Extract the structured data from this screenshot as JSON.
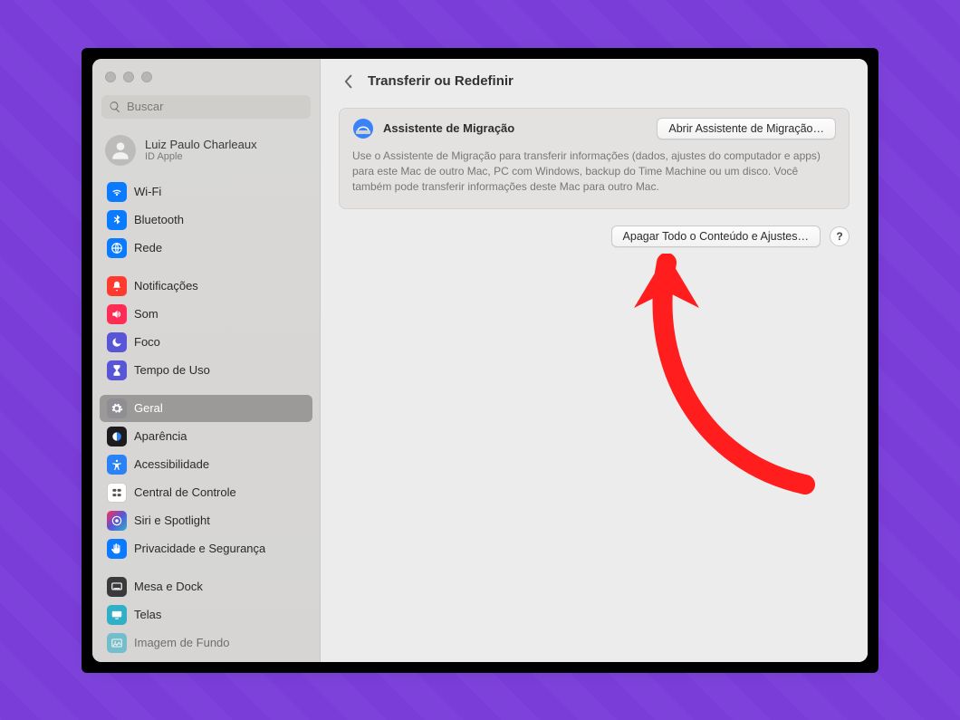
{
  "search": {
    "placeholder": "Buscar"
  },
  "user": {
    "name": "Luiz Paulo Charleaux",
    "subtitle": "ID Apple"
  },
  "sidebar": {
    "groups": [
      {
        "items": [
          {
            "label": "Wi-Fi",
            "icon": "wifi",
            "bg": "bg-blue"
          },
          {
            "label": "Bluetooth",
            "icon": "bluetooth",
            "bg": "bg-blue"
          },
          {
            "label": "Rede",
            "icon": "network",
            "bg": "bg-blue"
          }
        ]
      },
      {
        "items": [
          {
            "label": "Notificações",
            "icon": "bell",
            "bg": "bg-red"
          },
          {
            "label": "Som",
            "icon": "sound",
            "bg": "bg-red2"
          },
          {
            "label": "Foco",
            "icon": "moon",
            "bg": "bg-indigo"
          },
          {
            "label": "Tempo de Uso",
            "icon": "hourglass",
            "bg": "bg-indigo"
          }
        ]
      },
      {
        "items": [
          {
            "label": "Geral",
            "icon": "gear",
            "bg": "bg-gray",
            "selected": true
          },
          {
            "label": "Aparência",
            "icon": "appearance",
            "bg": "bg-black"
          },
          {
            "label": "Acessibilidade",
            "icon": "accessibility",
            "bg": "bg-blue2"
          },
          {
            "label": "Central de Controle",
            "icon": "control",
            "bg": "bg-white-border"
          },
          {
            "label": "Siri e Spotlight",
            "icon": "siri",
            "bg": "bg-gradient"
          },
          {
            "label": "Privacidade e Segurança",
            "icon": "hand",
            "bg": "bg-blue"
          }
        ]
      },
      {
        "items": [
          {
            "label": "Mesa e Dock",
            "icon": "dock",
            "bg": "bg-dark"
          },
          {
            "label": "Telas",
            "icon": "display",
            "bg": "bg-teal"
          },
          {
            "label": "Imagem de Fundo",
            "icon": "wallpaper",
            "bg": "bg-teal",
            "cut": true
          }
        ]
      }
    ]
  },
  "header": {
    "title": "Transferir ou Redefinir"
  },
  "migration": {
    "title": "Assistente de Migração",
    "button": "Abrir Assistente de Migração…",
    "description": "Use o Assistente de Migração para transferir informações (dados, ajustes do computador e apps) para este Mac de outro Mac, PC com Windows, backup do Time Machine ou um disco. Você também pode transferir informações deste Mac para outro Mac."
  },
  "erase": {
    "button": "Apagar Todo o Conteúdo e Ajustes…",
    "help": "?"
  },
  "colors": {
    "annotation": "#ff0000"
  }
}
